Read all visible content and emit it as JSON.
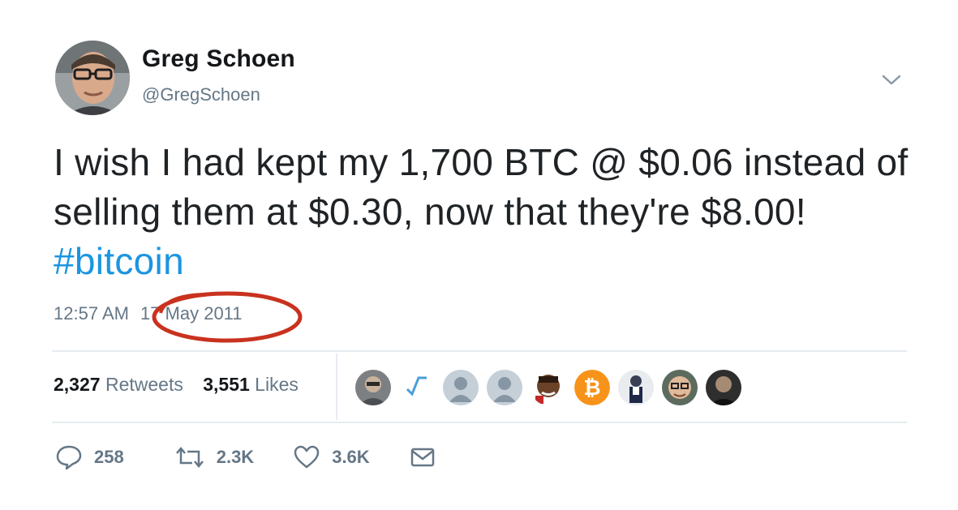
{
  "user": {
    "display_name": "Greg Schoen",
    "handle": "@GregSchoen"
  },
  "tweet": {
    "text": "I wish I had kept my 1,700 BTC @ $0.06 instead of selling them at $0.30, now that they're $8.00!",
    "hashtag": "#bitcoin",
    "time": "12:57 AM",
    "date": "17 May 2011"
  },
  "stats": {
    "retweets_count": "2,327",
    "retweets_label": "Retweets",
    "likes_count": "3,551",
    "likes_label": "Likes"
  },
  "actions": {
    "replies": "258",
    "retweets": "2.3K",
    "likes": "3.6K"
  },
  "colors": {
    "hashtag": "#1b95e0",
    "muted": "#657786",
    "annotation": "#c9321f",
    "bitcoin": "#f7931a"
  },
  "icons": {
    "more": "chevron-down-icon",
    "reply": "speech-bubble-icon",
    "retweet": "retweet-arrows-icon",
    "like": "heart-icon",
    "message": "envelope-icon"
  }
}
